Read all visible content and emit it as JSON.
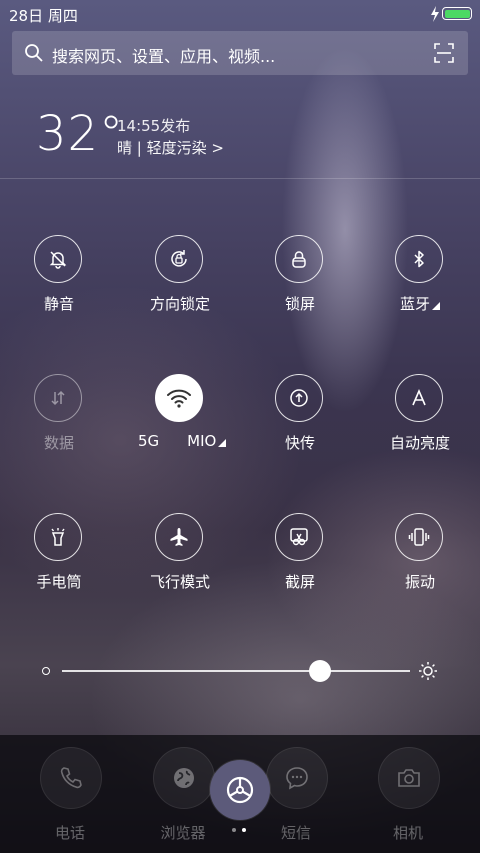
{
  "status_bar": {
    "date": "28日 周四",
    "battery_color": "#4cd964"
  },
  "search": {
    "placeholder": "搜索网页、设置、应用、视频..."
  },
  "weather": {
    "temperature": "32°",
    "publish_time": "14:55发布",
    "condition": "晴 | 轻度污染 >"
  },
  "toggles": [
    {
      "label": "静音",
      "icon": "bell-off-icon",
      "state": "off"
    },
    {
      "label": "方向锁定",
      "icon": "rotation-lock-icon",
      "state": "off"
    },
    {
      "label": "锁屏",
      "icon": "lock-icon",
      "state": "off"
    },
    {
      "label": "蓝牙",
      "icon": "bluetooth-icon",
      "state": "off"
    },
    {
      "label": "数据",
      "icon": "mobile-data-icon",
      "state": "disabled"
    },
    {
      "label_left": "5G",
      "label_right": "MIO",
      "icon": "wifi-icon",
      "state": "on"
    },
    {
      "label": "快传",
      "icon": "share-upload-icon",
      "state": "off"
    },
    {
      "label": "自动亮度",
      "icon": "auto-brightness-icon",
      "state": "off"
    },
    {
      "label": "手电筒",
      "icon": "flashlight-icon",
      "state": "off"
    },
    {
      "label": "飞行模式",
      "icon": "airplane-icon",
      "state": "off"
    },
    {
      "label": "截屏",
      "icon": "screenshot-icon",
      "state": "off"
    },
    {
      "label": "振动",
      "icon": "vibrate-icon",
      "state": "off"
    }
  ],
  "brightness": {
    "level": 0.74
  },
  "dock": {
    "apps": [
      {
        "label": "电话",
        "icon": "phone-icon"
      },
      {
        "label": "浏览器",
        "icon": "globe-icon"
      },
      {
        "label": "短信",
        "icon": "message-icon"
      },
      {
        "label": "相机",
        "icon": "camera-icon"
      }
    ],
    "settings_icon": "gear-icon",
    "page_count": 2,
    "current_page": 2
  }
}
